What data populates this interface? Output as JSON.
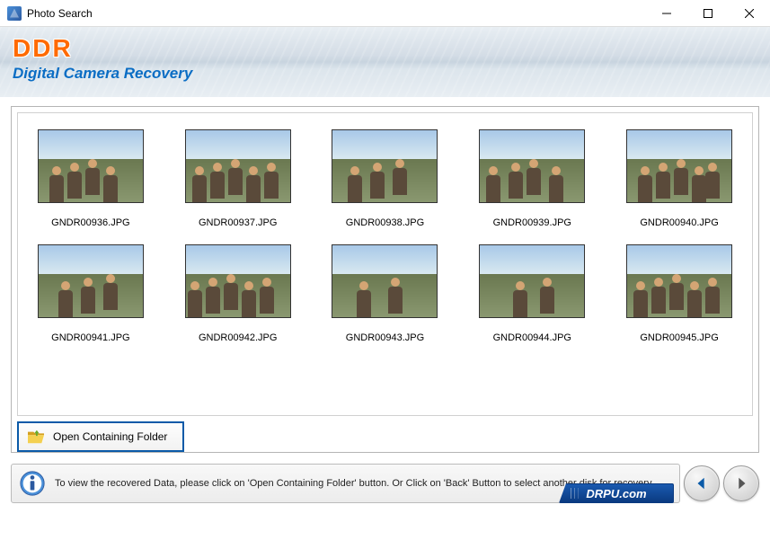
{
  "window": {
    "title": "Photo Search"
  },
  "header": {
    "logo": "DDR",
    "subtitle": "Digital Camera Recovery"
  },
  "gallery": {
    "items": [
      {
        "filename": "GNDR00936.JPG"
      },
      {
        "filename": "GNDR00937.JPG"
      },
      {
        "filename": "GNDR00938.JPG"
      },
      {
        "filename": "GNDR00939.JPG"
      },
      {
        "filename": "GNDR00940.JPG"
      },
      {
        "filename": "GNDR00941.JPG"
      },
      {
        "filename": "GNDR00942.JPG"
      },
      {
        "filename": "GNDR00943.JPG"
      },
      {
        "filename": "GNDR00944.JPG"
      },
      {
        "filename": "GNDR00945.JPG"
      }
    ]
  },
  "buttons": {
    "open_folder": "Open Containing Folder"
  },
  "footer": {
    "info_text": "To view the recovered Data, please click on 'Open Containing Folder' button. Or Click on 'Back' Button to select another disk for recovery.",
    "badge": "DRPU.com"
  },
  "colors": {
    "accent_orange": "#ff6a00",
    "accent_blue": "#0a6dc4",
    "button_border": "#0a5aa8"
  }
}
